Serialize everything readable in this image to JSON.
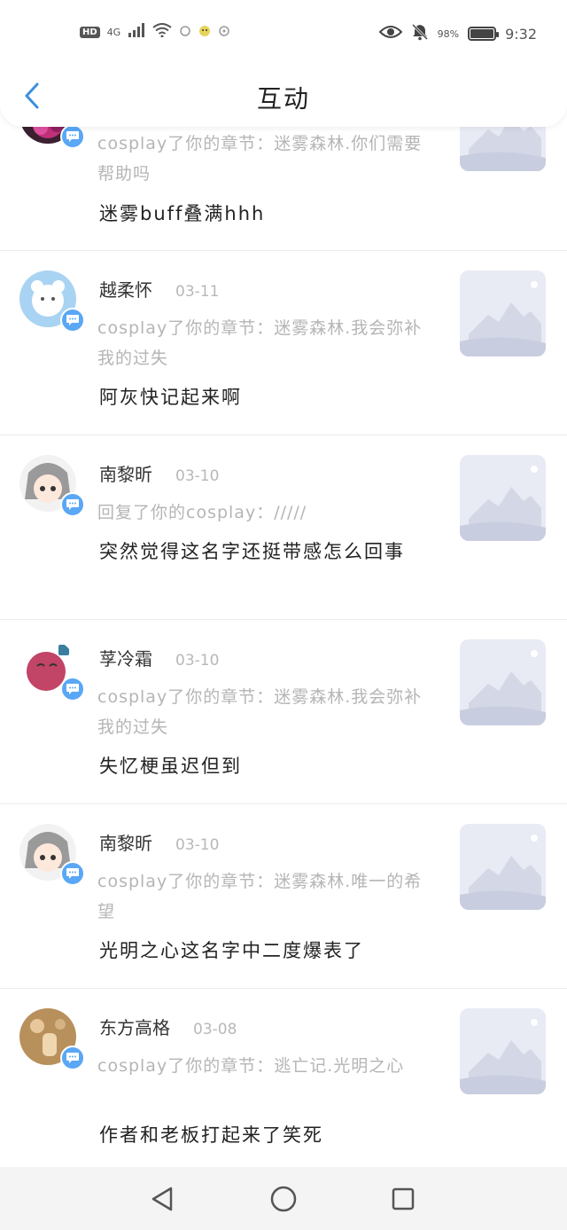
{
  "status_bar": {
    "hd": "HD",
    "network": "4G",
    "battery_text": "98%",
    "time": "9:32",
    "battery_level": 0.98,
    "icons": [
      "signal-icon",
      "wifi-icon",
      "app-icon",
      "app-icon",
      "app-icon",
      "eye-icon",
      "bell-off-icon",
      "battery-icon"
    ]
  },
  "header": {
    "title": "互动",
    "back_icon": "chevron-left-icon"
  },
  "items": [
    {
      "name": "",
      "date": "",
      "desc": "cosplay了你的章节：迷雾森林.你们需要帮助吗",
      "comment": "迷雾buff叠满hhh",
      "avatar": "rose"
    },
    {
      "name": "越柔怀",
      "date": "03-11",
      "desc": "cosplay了你的章节：迷雾森林.我会弥补我的过失",
      "comment": "阿灰快记起来啊",
      "avatar": "bear"
    },
    {
      "name": "南黎昕",
      "date": "03-10",
      "desc": "回复了你的cosplay：/////",
      "comment": "突然觉得这名字还挺带感怎么回事",
      "avatar": "anime"
    },
    {
      "name": "莩冷霜",
      "date": "03-10",
      "desc": "cosplay了你的章节：迷雾森林.我会弥补我的过失",
      "comment": "失忆梗虽迟但到",
      "avatar": "ball"
    },
    {
      "name": "南黎昕",
      "date": "03-10",
      "desc": "cosplay了你的章节：迷雾森林.唯一的希望",
      "comment": "光明之心这名字中二度爆表了",
      "avatar": "anime"
    },
    {
      "name": "东方高格",
      "date": "03-08",
      "desc": "cosplay了你的章节：逃亡记.光明之心",
      "comment": "作者和老板打起来了笑死",
      "avatar": "chess"
    }
  ],
  "navbar": {
    "back": "back-triangle-icon",
    "home": "home-circle-icon",
    "recents": "recents-square-icon"
  }
}
